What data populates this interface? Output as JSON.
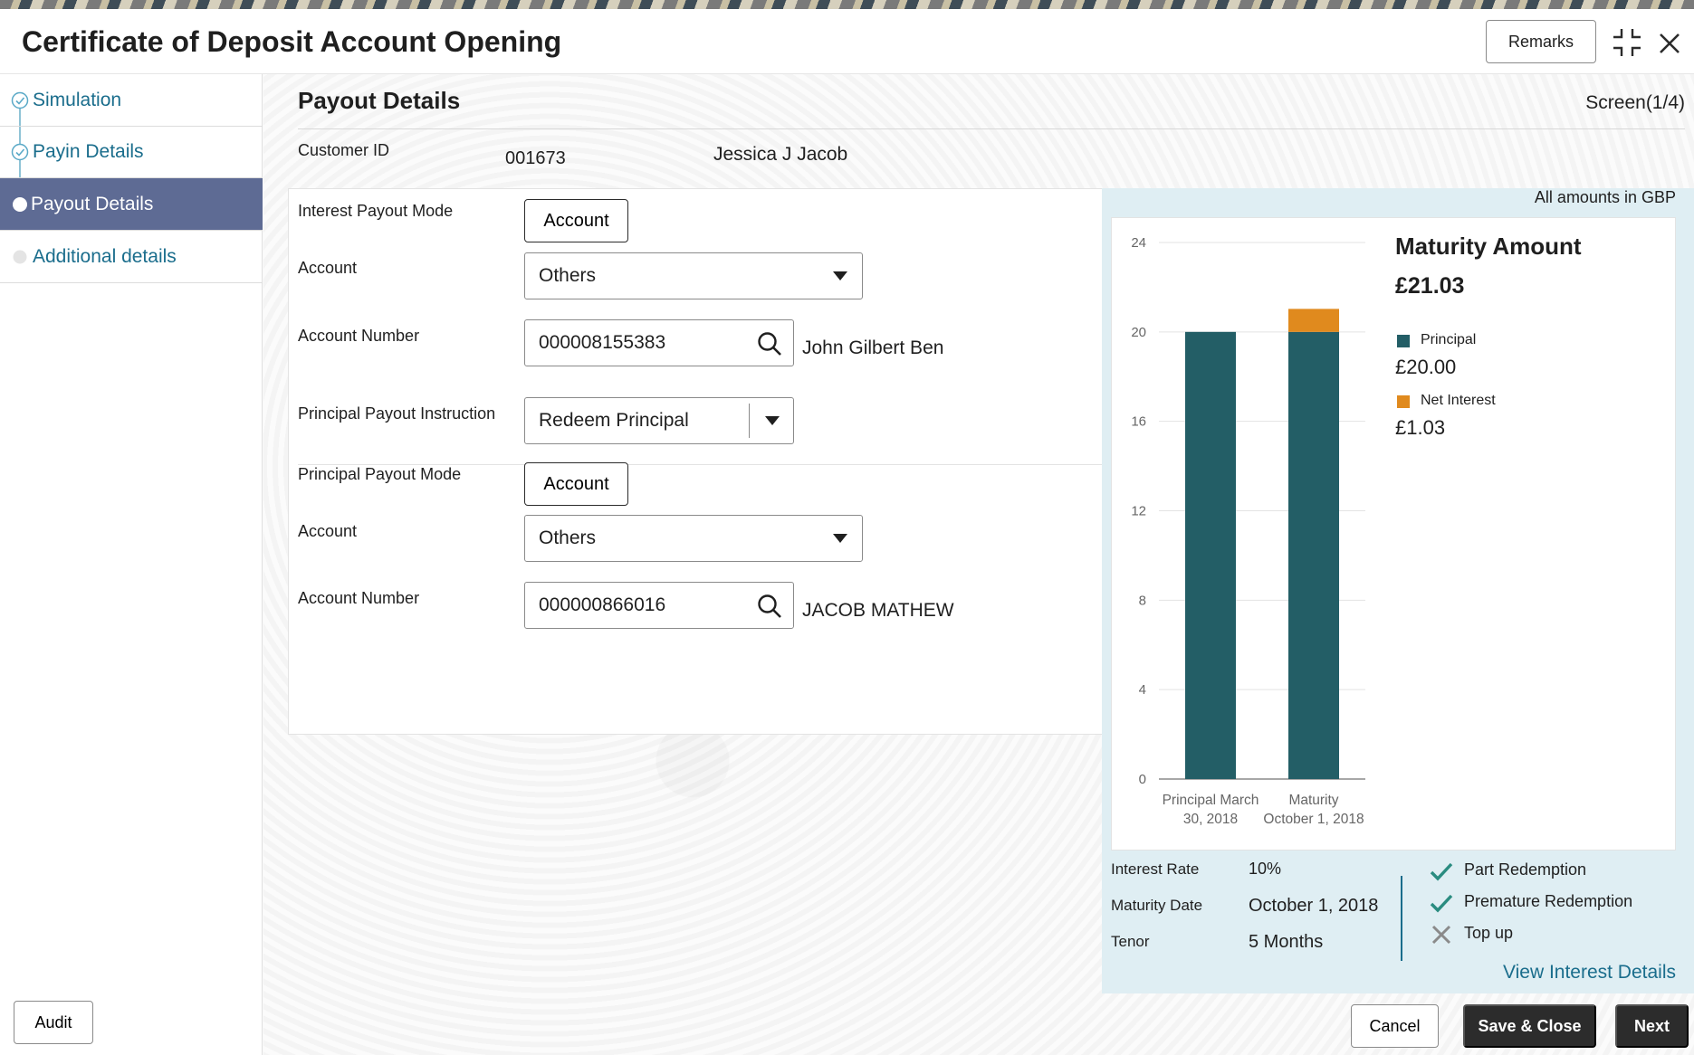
{
  "window": {
    "title": "Certificate of Deposit Account Opening",
    "remarks_label": "Remarks"
  },
  "sidebar": {
    "items": [
      {
        "label": "Simulation",
        "state": "done"
      },
      {
        "label": "Payin Details",
        "state": "done"
      },
      {
        "label": "Payout Details",
        "state": "active"
      },
      {
        "label": "Additional details",
        "state": "pending"
      }
    ]
  },
  "main": {
    "section_title": "Payout Details",
    "screen_indicator": "Screen(1/4)",
    "customer": {
      "label": "Customer ID",
      "id": "001673",
      "name": "Jessica J Jacob"
    },
    "interest": {
      "mode_label": "Interest Payout Mode",
      "mode_value": "Account",
      "account_label": "Account",
      "account_value": "Others",
      "number_label": "Account Number",
      "number_value": "000008155383",
      "holder": "John Gilbert Ben"
    },
    "principal": {
      "instruction_label": "Principal Payout Instruction",
      "instruction_value": "Redeem Principal",
      "mode_label": "Principal Payout Mode",
      "mode_value": "Account",
      "account_label": "Account",
      "account_value": "Others",
      "number_label": "Account Number",
      "number_value": "000000866016",
      "holder": "JACOB MATHEW"
    }
  },
  "summary": {
    "amounts_note": "All amounts in GBP",
    "maturity_title": "Maturity Amount",
    "maturity_value": "£21.03",
    "legend": [
      {
        "label": "Principal",
        "value": "£20.00",
        "color": "#235e66"
      },
      {
        "label": "Net Interest",
        "value": "£1.03",
        "color": "#e08a1e"
      }
    ],
    "info": {
      "rate_label": "Interest Rate",
      "rate_value": "10%",
      "date_label": "Maturity Date",
      "date_value": "October 1, 2018",
      "tenor_label": "Tenor",
      "tenor_value": "5 Months"
    },
    "features": [
      {
        "label": "Part Redemption",
        "enabled": true
      },
      {
        "label": "Premature Redemption",
        "enabled": true
      },
      {
        "label": "Top up",
        "enabled": false
      }
    ],
    "view_link": "View Interest Details"
  },
  "chart_data": {
    "type": "bar",
    "stacked": true,
    "categories": [
      [
        "Principal March",
        "30, 2018"
      ],
      [
        "Maturity",
        "October 1, 2018"
      ]
    ],
    "series": [
      {
        "name": "Principal",
        "values": [
          20,
          20
        ],
        "color": "#235e66"
      },
      {
        "name": "Net Interest",
        "values": [
          0,
          1.03
        ],
        "color": "#e08a1e"
      }
    ],
    "yticks": [
      0,
      4,
      8,
      12,
      16,
      20,
      24
    ],
    "ylim": [
      0,
      24
    ],
    "grid": true
  },
  "footer": {
    "audit_label": "Audit",
    "cancel_label": "Cancel",
    "save_close_label": "Save & Close",
    "next_label": "Next"
  }
}
